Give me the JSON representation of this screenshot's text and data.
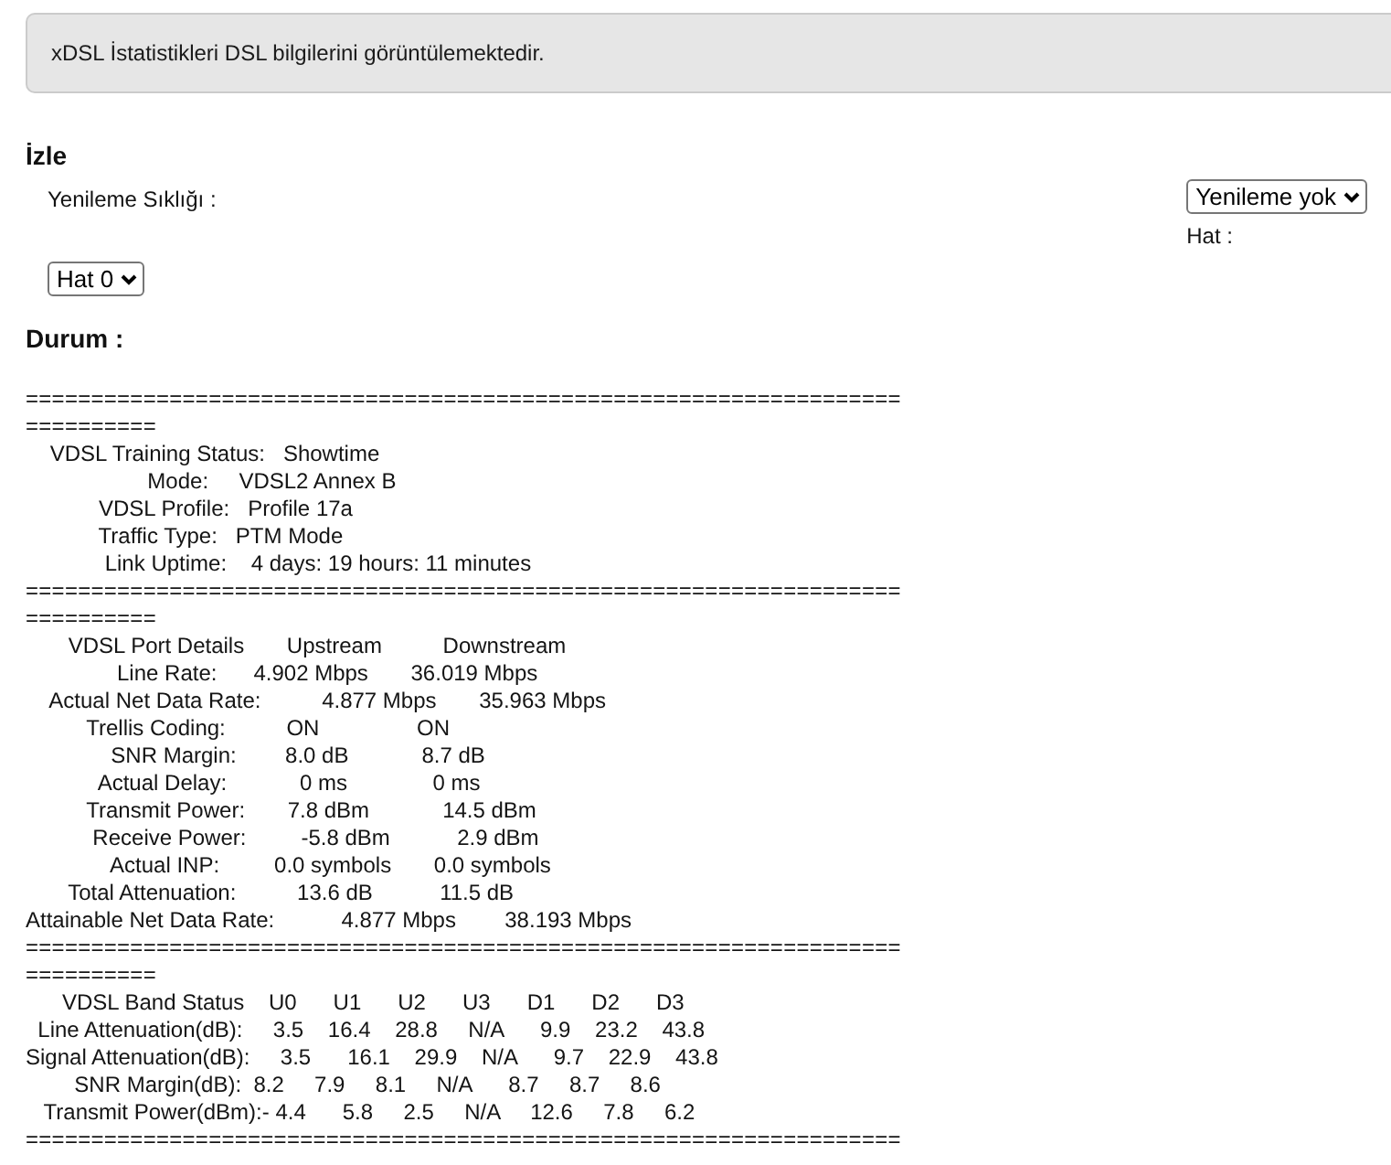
{
  "banner": {
    "text": "xDSL İstatistikleri DSL bilgilerini görüntülemektedir."
  },
  "monitor": {
    "title": "İzle",
    "refresh_frequency": {
      "label": "Yenileme Sıklığı :",
      "value": "Yenileme yok"
    },
    "line": {
      "label": "Hat :",
      "value": "Hat 0"
    }
  },
  "status": {
    "title": "Durum :",
    "lines": [
      {
        "kind": "separator",
        "text": "==================================================================="
      },
      {
        "kind": "separator",
        "text": "=========="
      },
      {
        "kind": "text",
        "text": "    VDSL Training Status:   Showtime"
      },
      {
        "kind": "text",
        "text": "                    Mode:     VDSL2 Annex B"
      },
      {
        "kind": "text",
        "text": "            VDSL Profile:   Profile 17a"
      },
      {
        "kind": "text",
        "text": "            Traffic Type:   PTM Mode"
      },
      {
        "kind": "text",
        "text": "             Link Uptime:    4 days: 19 hours: 11 minutes"
      },
      {
        "kind": "separator",
        "text": "==================================================================="
      },
      {
        "kind": "separator",
        "text": "=========="
      },
      {
        "kind": "text",
        "text": "       VDSL Port Details       Upstream          Downstream"
      },
      {
        "kind": "text",
        "text": "               Line Rate:      4.902 Mbps       36.019 Mbps"
      },
      {
        "kind": "text",
        "text": "    Actual Net Data Rate:          4.877 Mbps       35.963 Mbps"
      },
      {
        "kind": "text",
        "text": "          Trellis Coding:          ON                ON"
      },
      {
        "kind": "text",
        "text": "              SNR Margin:        8.0 dB            8.7 dB"
      },
      {
        "kind": "text",
        "text": "            Actual Delay:            0 ms              0 ms"
      },
      {
        "kind": "text",
        "text": "          Transmit Power:       7.8 dBm            14.5 dBm"
      },
      {
        "kind": "text",
        "text": "           Receive Power:         -5.8 dBm           2.9 dBm"
      },
      {
        "kind": "text",
        "text": "              Actual INP:         0.0 symbols       0.0 symbols"
      },
      {
        "kind": "text",
        "text": "       Total Attenuation:          13.6 dB           11.5 dB"
      },
      {
        "kind": "text",
        "text": "Attainable Net Data Rate:           4.877 Mbps        38.193 Mbps"
      },
      {
        "kind": "separator",
        "text": "==================================================================="
      },
      {
        "kind": "separator",
        "text": "=========="
      },
      {
        "kind": "text",
        "text": "      VDSL Band Status    U0      U1      U2      U3      D1      D2      D3"
      },
      {
        "kind": "text",
        "text": "  Line Attenuation(dB):     3.5    16.4    28.8     N/A      9.9    23.2    43.8"
      },
      {
        "kind": "text",
        "text": "Signal Attenuation(dB):     3.5      16.1    29.9    N/A      9.7    22.9    43.8"
      },
      {
        "kind": "text",
        "text": "        SNR Margin(dB):  8.2     7.9     8.1     N/A      8.7     8.7     8.6"
      },
      {
        "kind": "text",
        "text": "   Transmit Power(dBm):- 4.4      5.8     2.5     N/A     12.6     7.8     6.2"
      },
      {
        "kind": "separator",
        "text": "==================================================================="
      }
    ]
  }
}
